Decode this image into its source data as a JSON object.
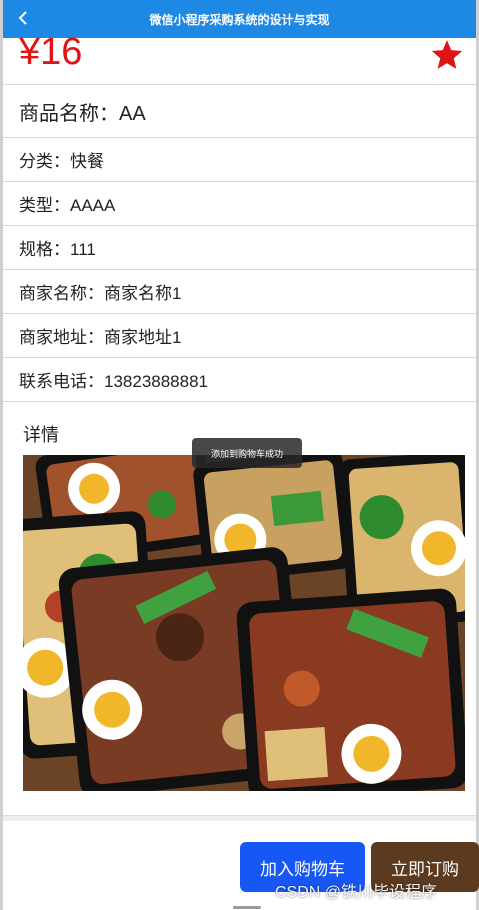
{
  "navbar": {
    "title": "微信小程序采购系统的设计与实现",
    "back_icon": "chevron-left-icon"
  },
  "product": {
    "price": "¥16",
    "favorite_icon": "star-icon",
    "favorite_color": "#e01414",
    "name": "商品名称：AA",
    "category": "分类：快餐",
    "type": "类型：AAAA",
    "spec": "规格：111",
    "merchant_name": "商家名称：商家名称1",
    "merchant_address": "商家地址：商家地址1",
    "phone": "联系电话：13823888881"
  },
  "detail": {
    "label": "详情",
    "image_icon": "food-photo"
  },
  "toast": {
    "text": "添加到购物车成功"
  },
  "actions": {
    "add_to_cart": "加入购物车",
    "order_now": "立即订购"
  },
  "watermark": "CSDN @铁川毕设程序",
  "colors": {
    "navbar": "#1e88e5",
    "price": "#e01414",
    "cart_button": "#1657f5",
    "order_button": "#5b3a1f"
  }
}
